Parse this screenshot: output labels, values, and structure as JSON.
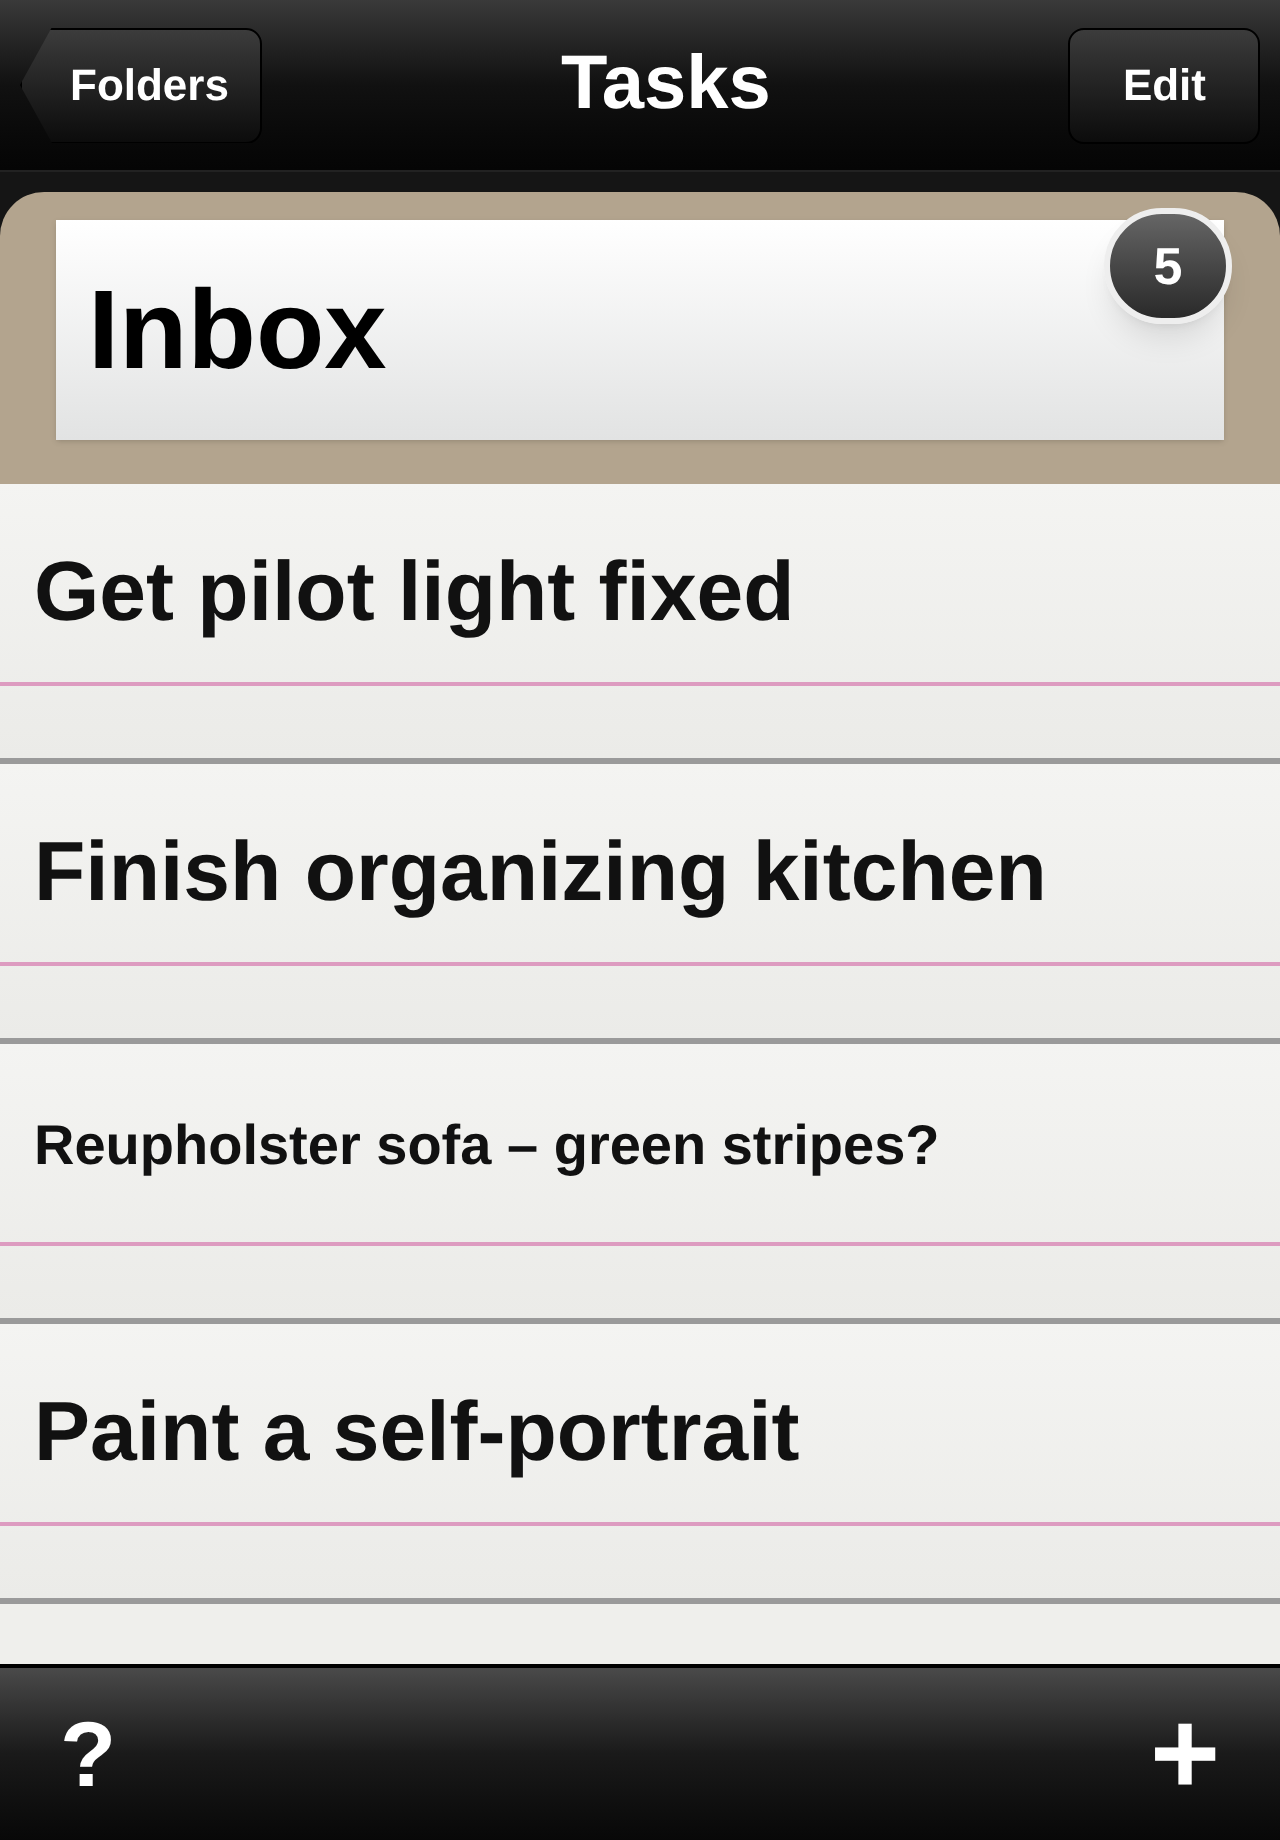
{
  "nav_bar": {
    "back_button": "Folders",
    "title": "Tasks",
    "edit_button": "Edit"
  },
  "folder": {
    "name": "Inbox",
    "count": "5"
  },
  "tasks": [
    {
      "title": "Get pilot light fixed"
    },
    {
      "title": "Finish organizing kitchen"
    },
    {
      "title": "Reupholster sofa – green stripes?"
    },
    {
      "title": "Paint a self-portrait"
    }
  ],
  "toolbar": {
    "help_button": "?",
    "add_button": "+"
  }
}
